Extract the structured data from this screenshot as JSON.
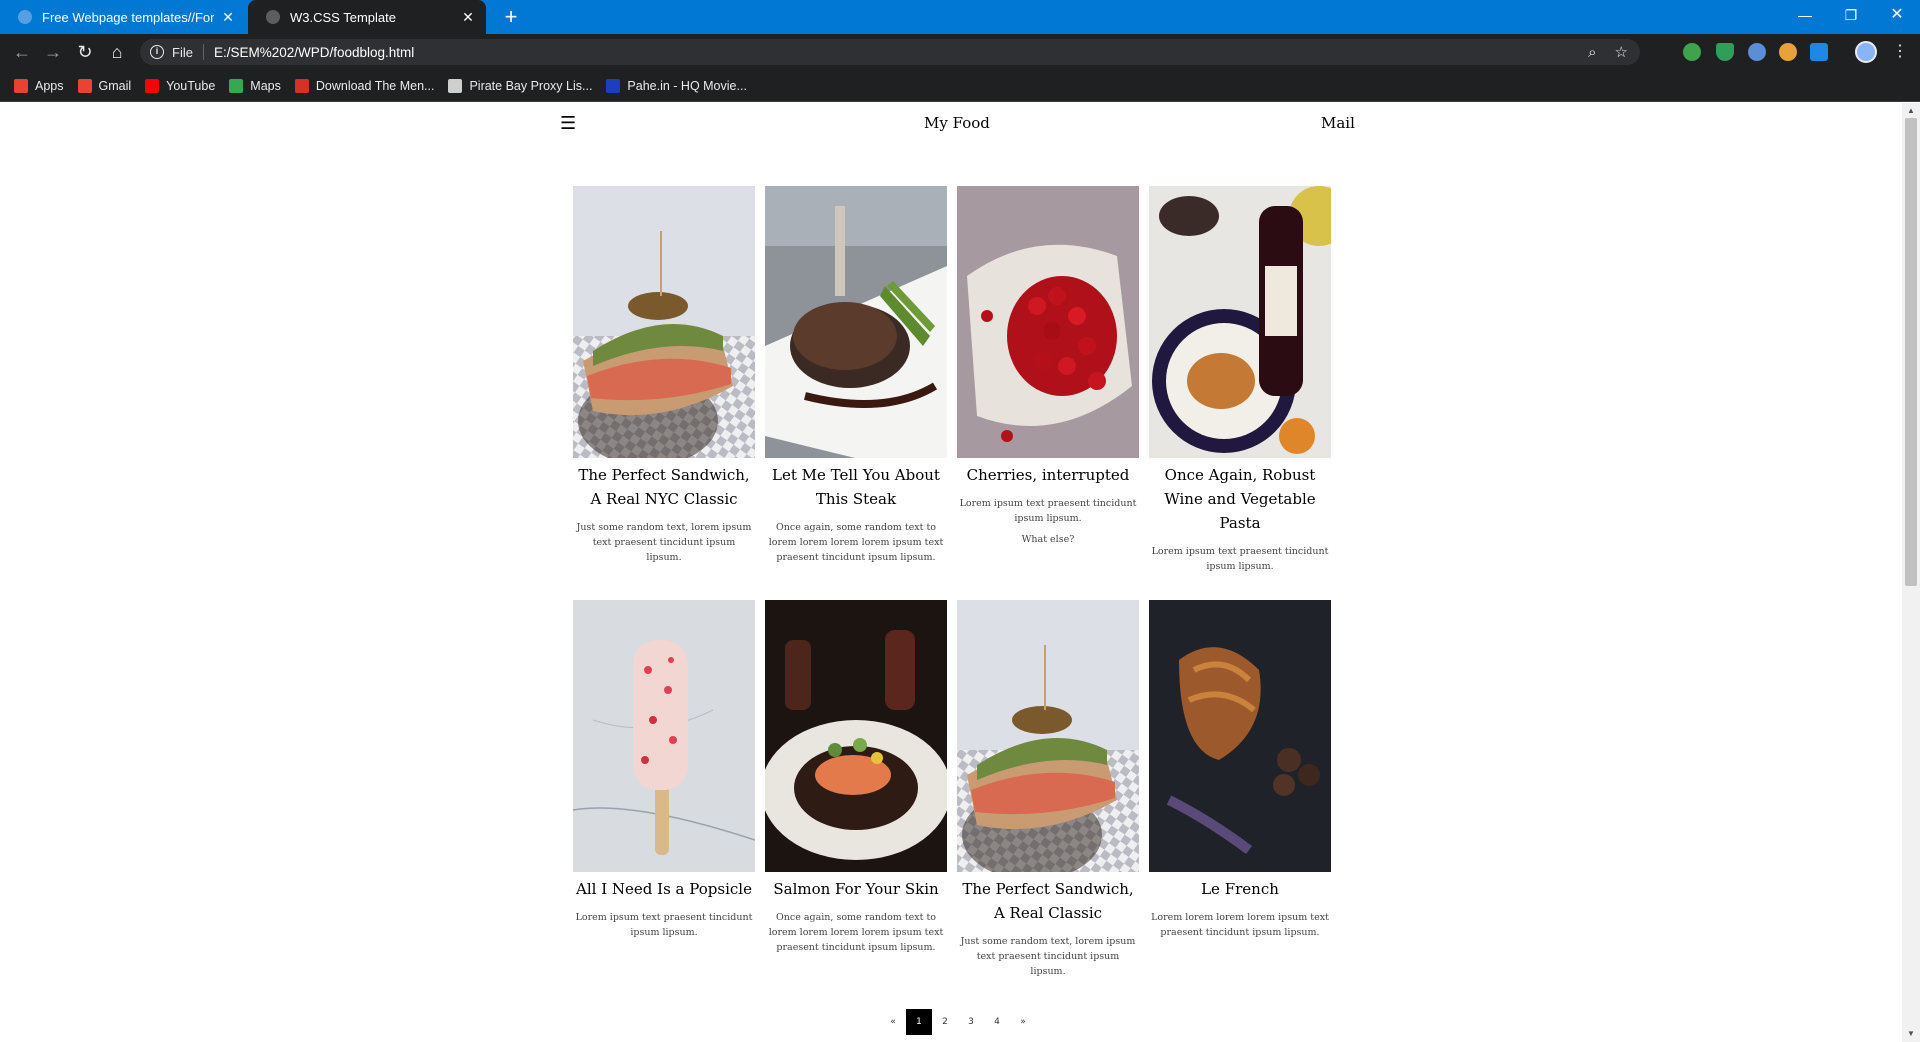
{
  "browser": {
    "tabs": [
      {
        "title": "Free Webpage templates//For ed",
        "close": "✕"
      },
      {
        "title": "W3.CSS Template",
        "close": "✕"
      }
    ],
    "new_tab": "+",
    "window_controls": {
      "minimize": "—",
      "maximize": "❐",
      "close": "✕"
    },
    "nav": {
      "back": "←",
      "forward": "→",
      "reload": "↻",
      "home": "⌂"
    },
    "address": {
      "scheme": "File",
      "url": "E:/SEM%202/WPD/foodblog.html",
      "zoom_icon": "⌕",
      "star_icon": "☆"
    },
    "menu": "⋮",
    "bookmarks": [
      {
        "label": "Apps",
        "color": "#e94235"
      },
      {
        "label": "Gmail",
        "color": "#ea4335"
      },
      {
        "label": "YouTube",
        "color": "#ff0000"
      },
      {
        "label": "Maps",
        "color": "#34a853"
      },
      {
        "label": "Download The Men...",
        "color": "#d93025"
      },
      {
        "label": "Pirate Bay Proxy Lis...",
        "color": "#cfcfcf"
      },
      {
        "label": "Pahe.in - HQ Movie...",
        "color": "#1a3fbf"
      }
    ]
  },
  "site": {
    "menu_icon": "☰",
    "brand": "My Food",
    "mail": "Mail"
  },
  "cards": [
    {
      "title": "The Perfect Sandwich, A Real NYC Classic",
      "text": [
        "Just some random text, lorem ipsum text praesent tincidunt ipsum lipsum."
      ],
      "image": "sandwich-photo"
    },
    {
      "title": "Let Me Tell You About This Steak",
      "text": [
        "Once again, some random text to lorem lorem lorem lorem ipsum text praesent tincidunt ipsum lipsum."
      ],
      "image": "steak-photo"
    },
    {
      "title": "Cherries, interrupted",
      "text": [
        "Lorem ipsum text praesent tincidunt ipsum lipsum.",
        "What else?"
      ],
      "image": "cherries-photo"
    },
    {
      "title": "Once Again, Robust Wine and Vegetable Pasta",
      "text": [
        "Lorem ipsum text praesent tincidunt ipsum lipsum."
      ],
      "image": "wine-pasta-photo"
    },
    {
      "title": "All I Need Is a Popsicle",
      "text": [
        "Lorem ipsum text praesent tincidunt ipsum lipsum."
      ],
      "image": "popsicle-photo"
    },
    {
      "title": "Salmon For Your Skin",
      "text": [
        "Once again, some random text to lorem lorem lorem lorem ipsum text praesent tincidunt ipsum lipsum."
      ],
      "image": "salmon-photo"
    },
    {
      "title": "The Perfect Sandwich, A Real Classic",
      "text": [
        "Just some random text, lorem ipsum text praesent tincidunt ipsum lipsum."
      ],
      "image": "sandwich-photo"
    },
    {
      "title": "Le French",
      "text": [
        "Lorem lorem lorem lorem ipsum text praesent tincidunt ipsum lipsum."
      ],
      "image": "croissant-photo"
    }
  ],
  "pagination": {
    "prev": "«",
    "pages": [
      "1",
      "2",
      "3",
      "4"
    ],
    "active": "1",
    "next": "»"
  }
}
